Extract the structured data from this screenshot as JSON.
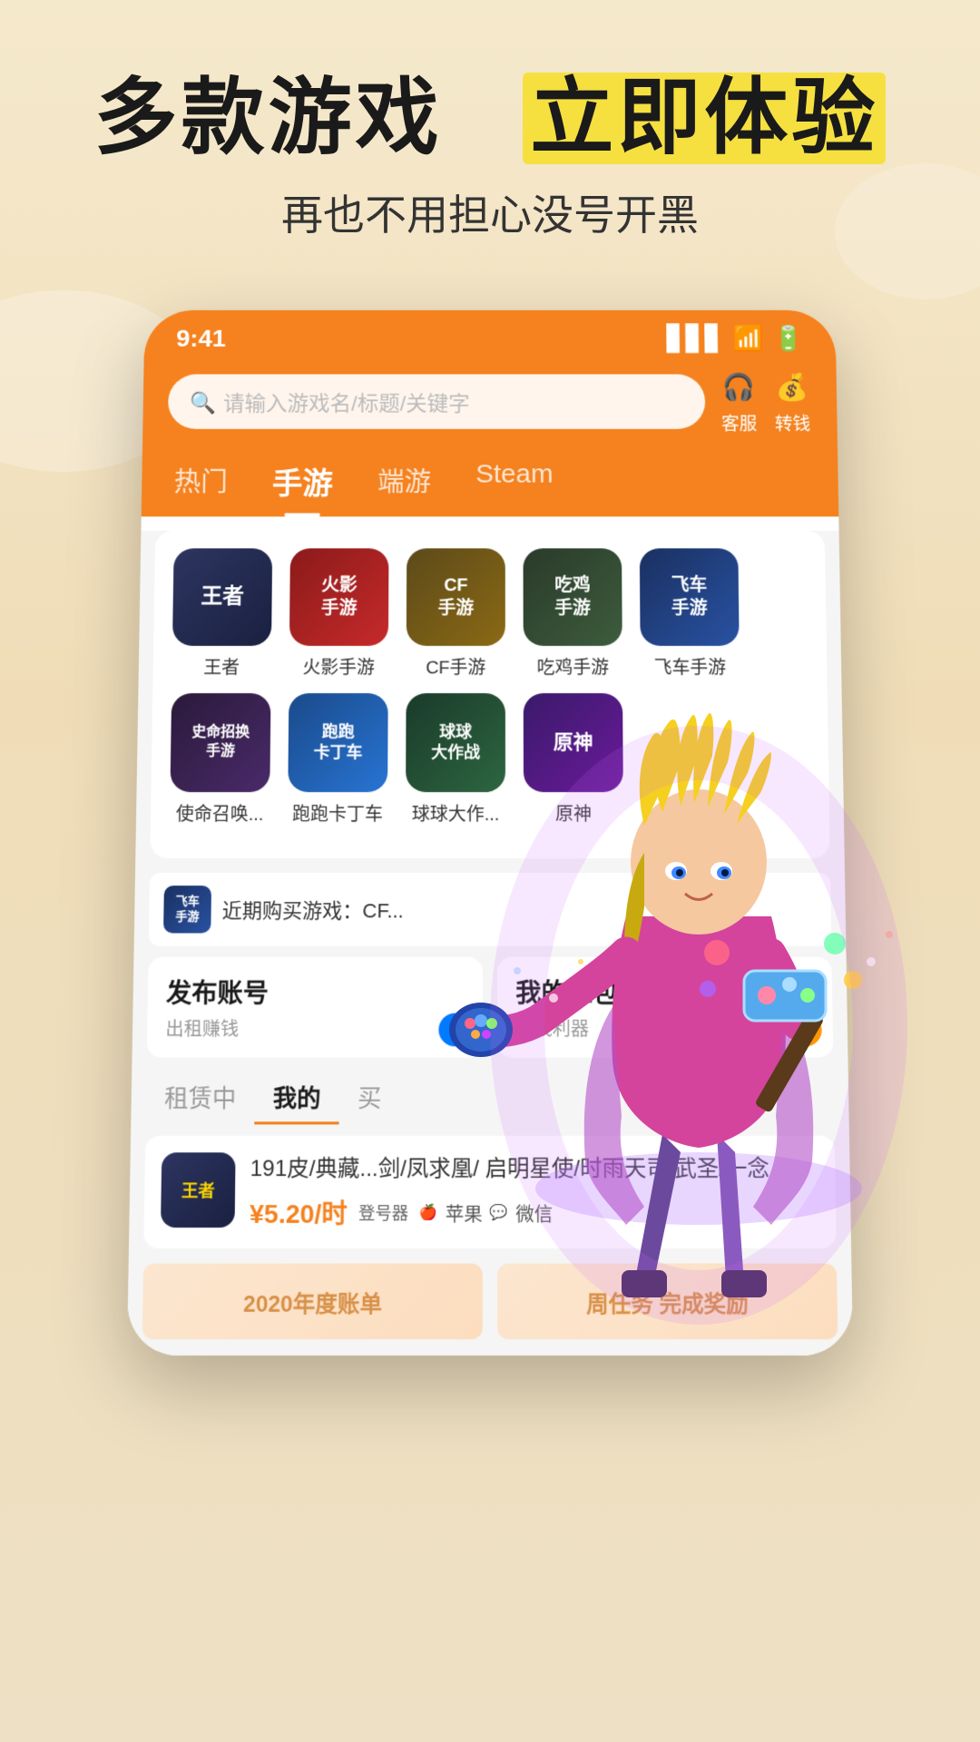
{
  "hero": {
    "title_part1": "多款游戏",
    "title_part2": "立即体验",
    "subtitle": "再也不用担心没号开黑"
  },
  "phone": {
    "status_time": "9:41",
    "search_placeholder": "请输入游戏名/标题/关键字",
    "action_customer": "客服",
    "action_transfer": "转钱",
    "nav_tabs": [
      {
        "label": "热门",
        "active": false
      },
      {
        "label": "手游",
        "active": true
      },
      {
        "label": "端游",
        "active": false
      },
      {
        "label": "Steam",
        "active": false
      }
    ],
    "games_row1": [
      {
        "name": "王者",
        "icon_text": "王者",
        "icon_class": "icon-wangzhe"
      },
      {
        "name": "火影手游",
        "icon_text": "火影\n手游",
        "icon_class": "icon-huoying"
      },
      {
        "name": "CF手游",
        "icon_text": "CF\n手游",
        "icon_class": "icon-cf"
      },
      {
        "name": "吃鸡手游",
        "icon_text": "吃鸡\n手游",
        "icon_class": "icon-jichi"
      },
      {
        "name": "飞车手游",
        "icon_text": "飞车\n手游",
        "icon_class": "icon-feiche"
      }
    ],
    "games_row2": [
      {
        "name": "使命召唤...",
        "icon_text": "史命招换\n手游",
        "icon_class": "icon-shiming"
      },
      {
        "name": "跑跑卡丁车",
        "icon_text": "跑跑\n卡丁车",
        "icon_class": "icon-paopao"
      },
      {
        "name": "球球大作...",
        "icon_text": "球球\n大作战",
        "icon_class": "icon-qiuqiu"
      },
      {
        "name": "原神",
        "icon_text": "原神",
        "icon_class": "icon-yuanshen"
      }
    ],
    "recent_text": "近期购买游戏：CF...",
    "recent_icon_text": "飞车\n手游",
    "quick_actions": [
      {
        "title": "发布账号",
        "subtitle": "出租赚钱",
        "icon": "+",
        "icon_color": "qa-blue"
      },
      {
        "title": "我的红包",
        "subtitle": "省钱利器",
        "icon": "¥",
        "icon_color": "qa-orange"
      }
    ],
    "content_tabs": [
      {
        "label": "租赁中",
        "active": false
      },
      {
        "label": "我的",
        "active": true
      },
      {
        "label": "买",
        "active": false
      }
    ],
    "listing": {
      "game_icon_text": "王者",
      "description": "191皮/典藏...剑/凤求凰/\n启明星使/时雨天司/武圣/一念",
      "price": "¥5.20/时",
      "tag_login": "登号器",
      "platforms": [
        "苹果",
        "微信"
      ]
    },
    "bottom_cards": [
      {
        "label": "2020年度账单"
      },
      {
        "label": "周任务 完成奖励"
      }
    ]
  }
}
